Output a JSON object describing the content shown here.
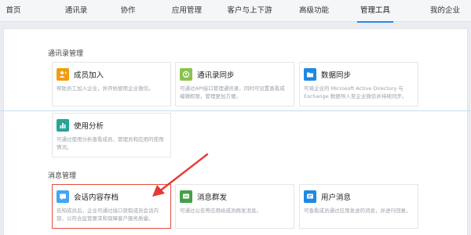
{
  "nav": {
    "tabs": [
      {
        "label": "首页",
        "active": false
      },
      {
        "label": "通讯录",
        "active": false
      },
      {
        "label": "协作",
        "active": false
      },
      {
        "label": "应用管理",
        "active": false
      },
      {
        "label": "客户与上下游",
        "active": false
      },
      {
        "label": "高级功能",
        "active": false
      },
      {
        "label": "管理工具",
        "active": true
      },
      {
        "label": "我的企业",
        "active": false
      }
    ]
  },
  "sections": {
    "contacts": {
      "title": "通讯录管理"
    },
    "messages": {
      "title": "消息管理"
    }
  },
  "cards": {
    "member_add": {
      "name": "成员加入",
      "desc": "帮助员工加入企业，并开始使用企业微信。",
      "icon": "person-plus-icon",
      "color": "#f39c12"
    },
    "contacts_sync": {
      "name": "通讯录同步",
      "desc": "可通过API接口管理通讯录，同时可设置查看成编辑权限，管理更加方便。",
      "icon": "sync-icon",
      "color": "#8bc34a"
    },
    "data_sync": {
      "name": "数据同步",
      "desc": "可将企业的 Microsoft Active Directory 与 Exchange 数据导入至企业微信并持续同步。",
      "icon": "folder-icon",
      "color": "#1e88e5"
    },
    "usage_analysis": {
      "name": "使用分析",
      "desc": "可通过使用分析查看成员、管理员和应用的使用情况。",
      "icon": "bar-chart-icon",
      "color": "#26a69a"
    },
    "chat_archive": {
      "name": "会话内容存档",
      "desc": "告知成员后，企业可通过接口获取成员会话内容，以符合监管要求和保障客户服务质量。",
      "icon": "chat-archive-icon",
      "color": "#42a5f5"
    },
    "broadcast": {
      "name": "消息群发",
      "desc": "可通过公告等应用给成员群发消息。",
      "icon": "broadcast-icon",
      "color": "#43a047"
    },
    "user_messages": {
      "name": "用户消息",
      "desc": "可查看成员通过应用发送的消息，并进行回复。",
      "icon": "user-message-icon",
      "color": "#1e88e5"
    }
  }
}
